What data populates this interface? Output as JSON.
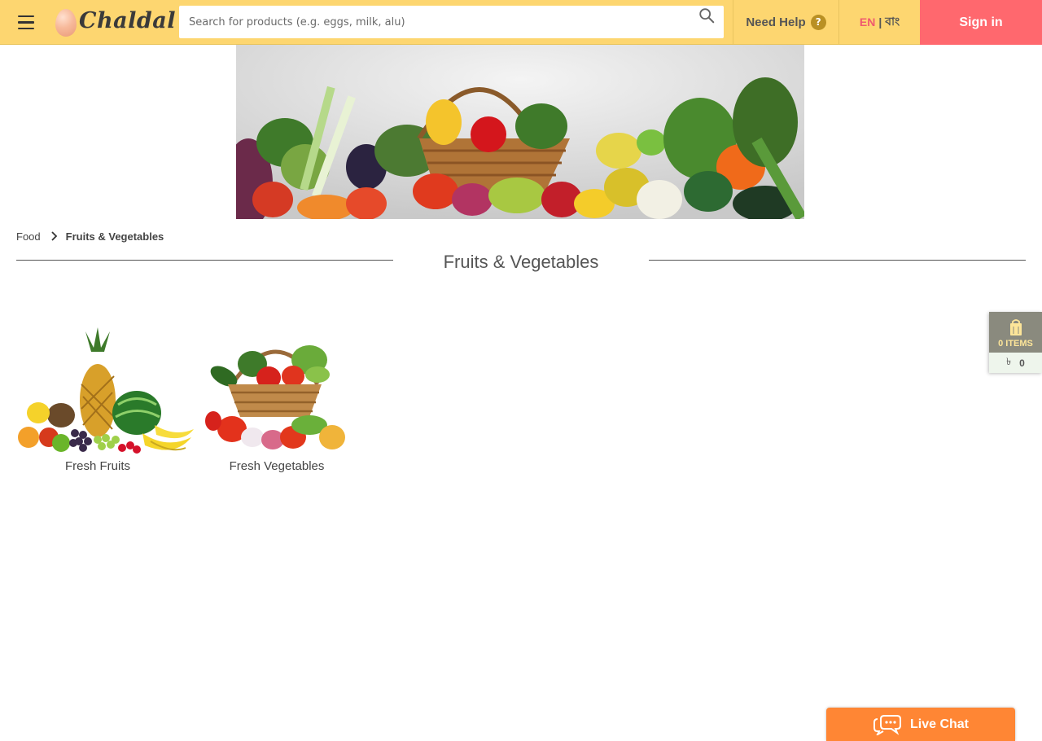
{
  "header": {
    "logo_text": "Chaldal",
    "search_placeholder": "Search for products (e.g. eggs, milk, alu)",
    "search_value": "",
    "help_label": "Need Help",
    "help_icon_glyph": "?",
    "lang_en": "EN",
    "lang_separator": "|",
    "lang_bn": "বাং",
    "signin_label": "Sign in"
  },
  "breadcrumb": {
    "items": [
      "Food",
      "Fruits & Vegetables"
    ]
  },
  "page": {
    "title": "Fruits & Vegetables"
  },
  "categories": [
    {
      "label": "Fresh Fruits",
      "image": "fresh-fruits-image"
    },
    {
      "label": "Fresh Vegetables",
      "image": "fresh-vegetables-image"
    }
  ],
  "cart": {
    "items_label": "0 ITEMS",
    "currency_symbol": "৳",
    "total": "0"
  },
  "livechat": {
    "label": "Live Chat"
  },
  "colors": {
    "header_bg": "#fdd670",
    "signin_bg": "#ff686e",
    "livechat_bg": "#ff8634",
    "lang_active": "#ef5a6f",
    "cart_bg": "#8a8a7e"
  }
}
